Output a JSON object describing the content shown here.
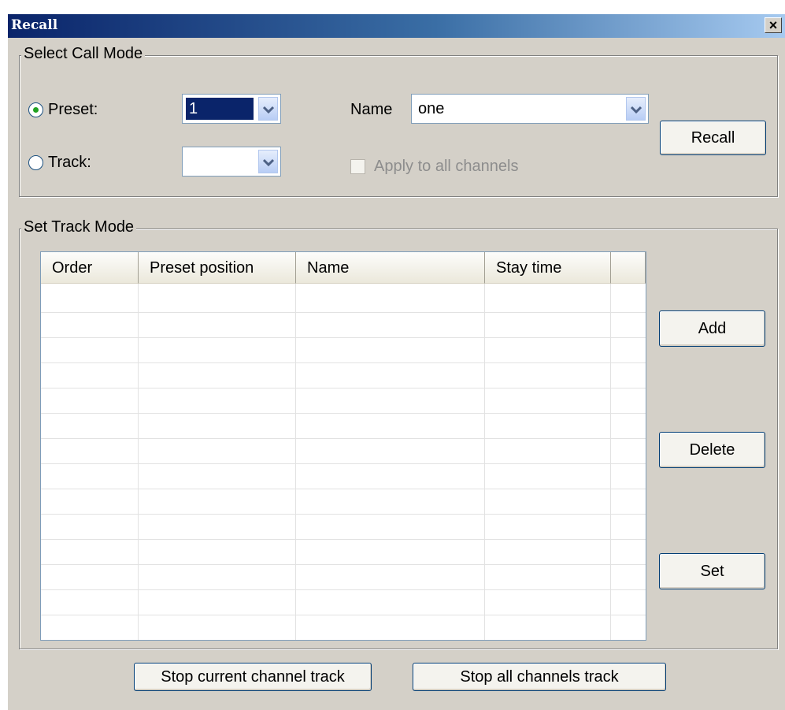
{
  "window": {
    "title": "Recall",
    "close_glyph": "×"
  },
  "select_call_mode": {
    "title": "Select Call Mode",
    "preset_label": "Preset:",
    "preset_value": "1",
    "track_label": "Track:",
    "track_value": "",
    "name_label": "Name",
    "name_value": "one",
    "apply_all_label": "Apply to all channels",
    "recall_button": "Recall"
  },
  "set_track_mode": {
    "title": "Set Track Mode",
    "columns": [
      "Order",
      "Preset position",
      "Name",
      "Stay time",
      ""
    ],
    "rows": [],
    "add_button": "Add",
    "delete_button": "Delete",
    "set_button": "Set"
  },
  "footer": {
    "stop_current_button": "Stop current channel track",
    "stop_all_button": "Stop all channels track"
  }
}
